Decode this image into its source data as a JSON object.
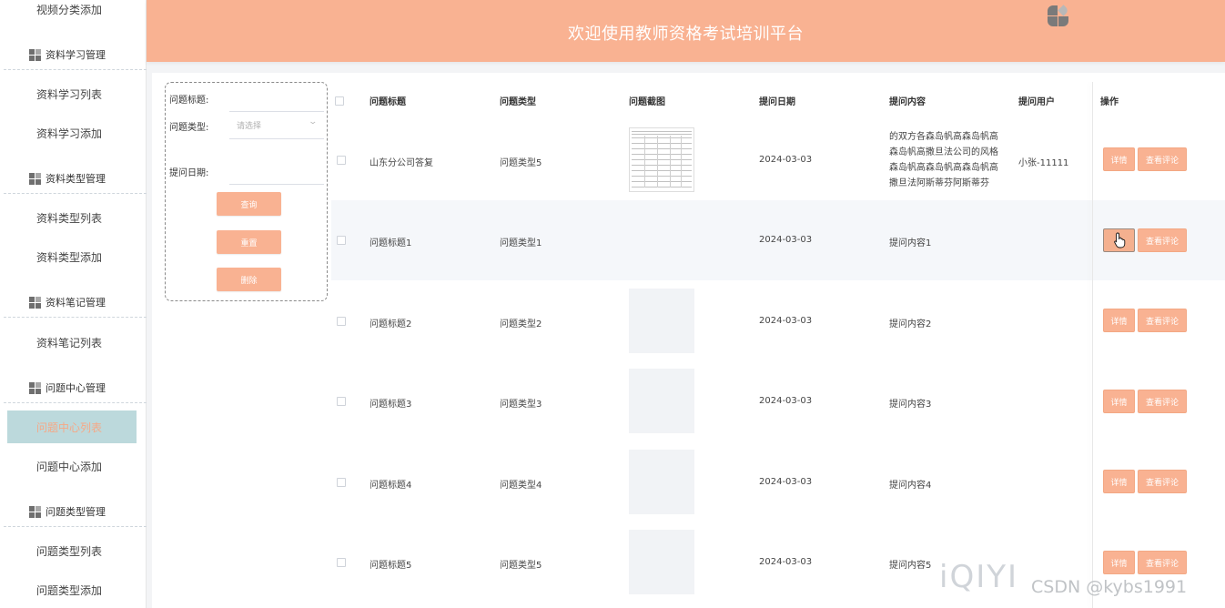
{
  "header": {
    "title": "欢迎使用教师资格考试培训平台",
    "logo_icon": "grid-logo-icon"
  },
  "sidebar": {
    "items": [
      {
        "type": "item",
        "label": "视频分类添加"
      },
      {
        "type": "group",
        "label": "资料学习管理"
      },
      {
        "type": "item",
        "label": "资料学习列表"
      },
      {
        "type": "item",
        "label": "资料学习添加"
      },
      {
        "type": "group",
        "label": "资料类型管理"
      },
      {
        "type": "item",
        "label": "资料类型列表"
      },
      {
        "type": "item",
        "label": "资料类型添加"
      },
      {
        "type": "group",
        "label": "资料笔记管理"
      },
      {
        "type": "item",
        "label": "资料笔记列表"
      },
      {
        "type": "group",
        "label": "问题中心管理"
      },
      {
        "type": "item",
        "label": "问题中心列表",
        "active": true
      },
      {
        "type": "item",
        "label": "问题中心添加"
      },
      {
        "type": "group",
        "label": "问题类型管理"
      },
      {
        "type": "item",
        "label": "问题类型列表"
      },
      {
        "type": "item",
        "label": "问题类型添加"
      }
    ]
  },
  "search": {
    "title_label": "问题标题:",
    "type_label": "问题类型:",
    "type_placeholder": "请选择",
    "date_label": "提问日期:",
    "query_button": "查询",
    "reset_button": "重置",
    "delete_button": "删除"
  },
  "table": {
    "headers": [
      "问题标题",
      "问题类型",
      "问题截图",
      "提问日期",
      "提问内容",
      "提问用户",
      "操作"
    ],
    "rows": [
      {
        "title": "山东分公司答复",
        "type": "问题类型5",
        "date": "2024-03-03",
        "content": "的双方各森岛帆高森岛帆高森岛帆高撒旦法公司的风格森岛帆高森岛帆高森岛帆高撒旦法阿斯蒂芬阿斯蒂芬",
        "user": "小张-11111"
      },
      {
        "title": "问题标题1",
        "type": "问题类型1",
        "date": "2024-03-03",
        "content": "提问内容1",
        "user": ""
      },
      {
        "title": "问题标题2",
        "type": "问题类型2",
        "date": "2024-03-03",
        "content": "提问内容2",
        "user": ""
      },
      {
        "title": "问题标题3",
        "type": "问题类型3",
        "date": "2024-03-03",
        "content": "提问内容3",
        "user": ""
      },
      {
        "title": "问题标题4",
        "type": "问题类型4",
        "date": "2024-03-03",
        "content": "提问内容4",
        "user": ""
      },
      {
        "title": "问题标题5",
        "type": "问题类型5",
        "date": "2024-03-03",
        "content": "提问内容5",
        "user": ""
      }
    ],
    "detail_label": "详情",
    "comment_label": "查看评论"
  },
  "watermark": {
    "iqiyi": "iQIYI",
    "csdn": "CSDN @kybs1991"
  },
  "colors": {
    "accent": "#f9b292",
    "sidebar_active_bg": "#bcd9dc"
  }
}
